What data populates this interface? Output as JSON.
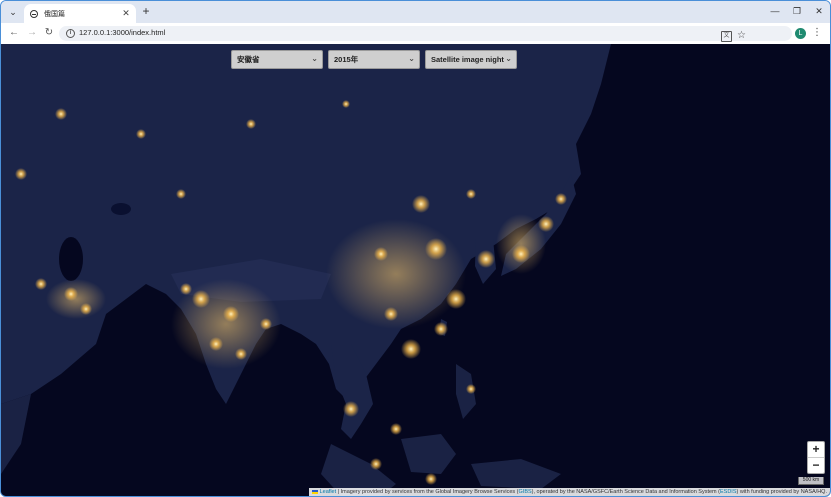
{
  "browser": {
    "tab_title": "俄国篇",
    "tab_close": "✕",
    "new_tab": "+",
    "url": "127.0.0.1:3000/index.html",
    "profile_initial": "L",
    "window_controls": {
      "minimize": "—",
      "restore": "❐",
      "close": "✕"
    }
  },
  "map_controls": {
    "region_select": "安徽省",
    "year_select": "2015年",
    "layer_select": "Satellite image night"
  },
  "zoom": {
    "in": "+",
    "out": "−"
  },
  "scale_label": "500 km",
  "attribution": {
    "leaflet": "Leaflet",
    "text_1": " | Imagery provided by services from the Global Imagery Browse Services (",
    "gibs": "GIBS",
    "text_2": "), operated by the NASA/GSFC/Earth Science Data and Information System (",
    "esdis": "ESDIS",
    "text_3": ") with funding provided by NASA/HQ."
  },
  "colors": {
    "ocean": "#05071f",
    "land": "#1b2448",
    "city_lights": "#ffd27a",
    "select_bg": "#cfcfcf",
    "window_border": "#4a8fd8"
  }
}
